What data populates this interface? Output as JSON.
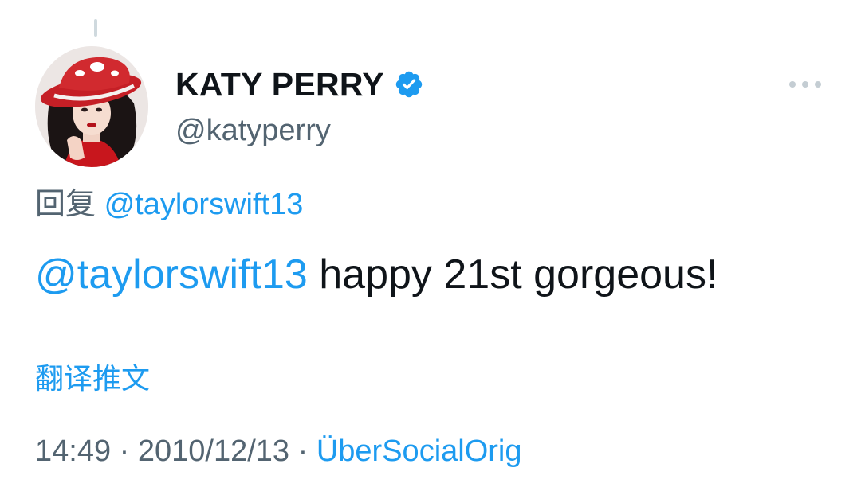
{
  "user": {
    "display_name": "KATY PERRY",
    "handle": "@katyperry",
    "verified": true,
    "avatar_icon": "profile-photo"
  },
  "reply": {
    "prefix": "回复",
    "to": "@taylorswift13"
  },
  "tweet": {
    "mention": "@taylorswift13",
    "text": "happy 21st gorgeous!"
  },
  "translate_label": "翻译推文",
  "meta": {
    "time": "14:49",
    "separator": "·",
    "date": "2010/12/13",
    "source": "ÜberSocialOrig"
  },
  "icons": {
    "verified": "verified-badge-icon",
    "more": "more-options-icon"
  },
  "colors": {
    "link": "#1d9bf0",
    "secondary_text": "#536471",
    "primary_text": "#0f1419"
  }
}
